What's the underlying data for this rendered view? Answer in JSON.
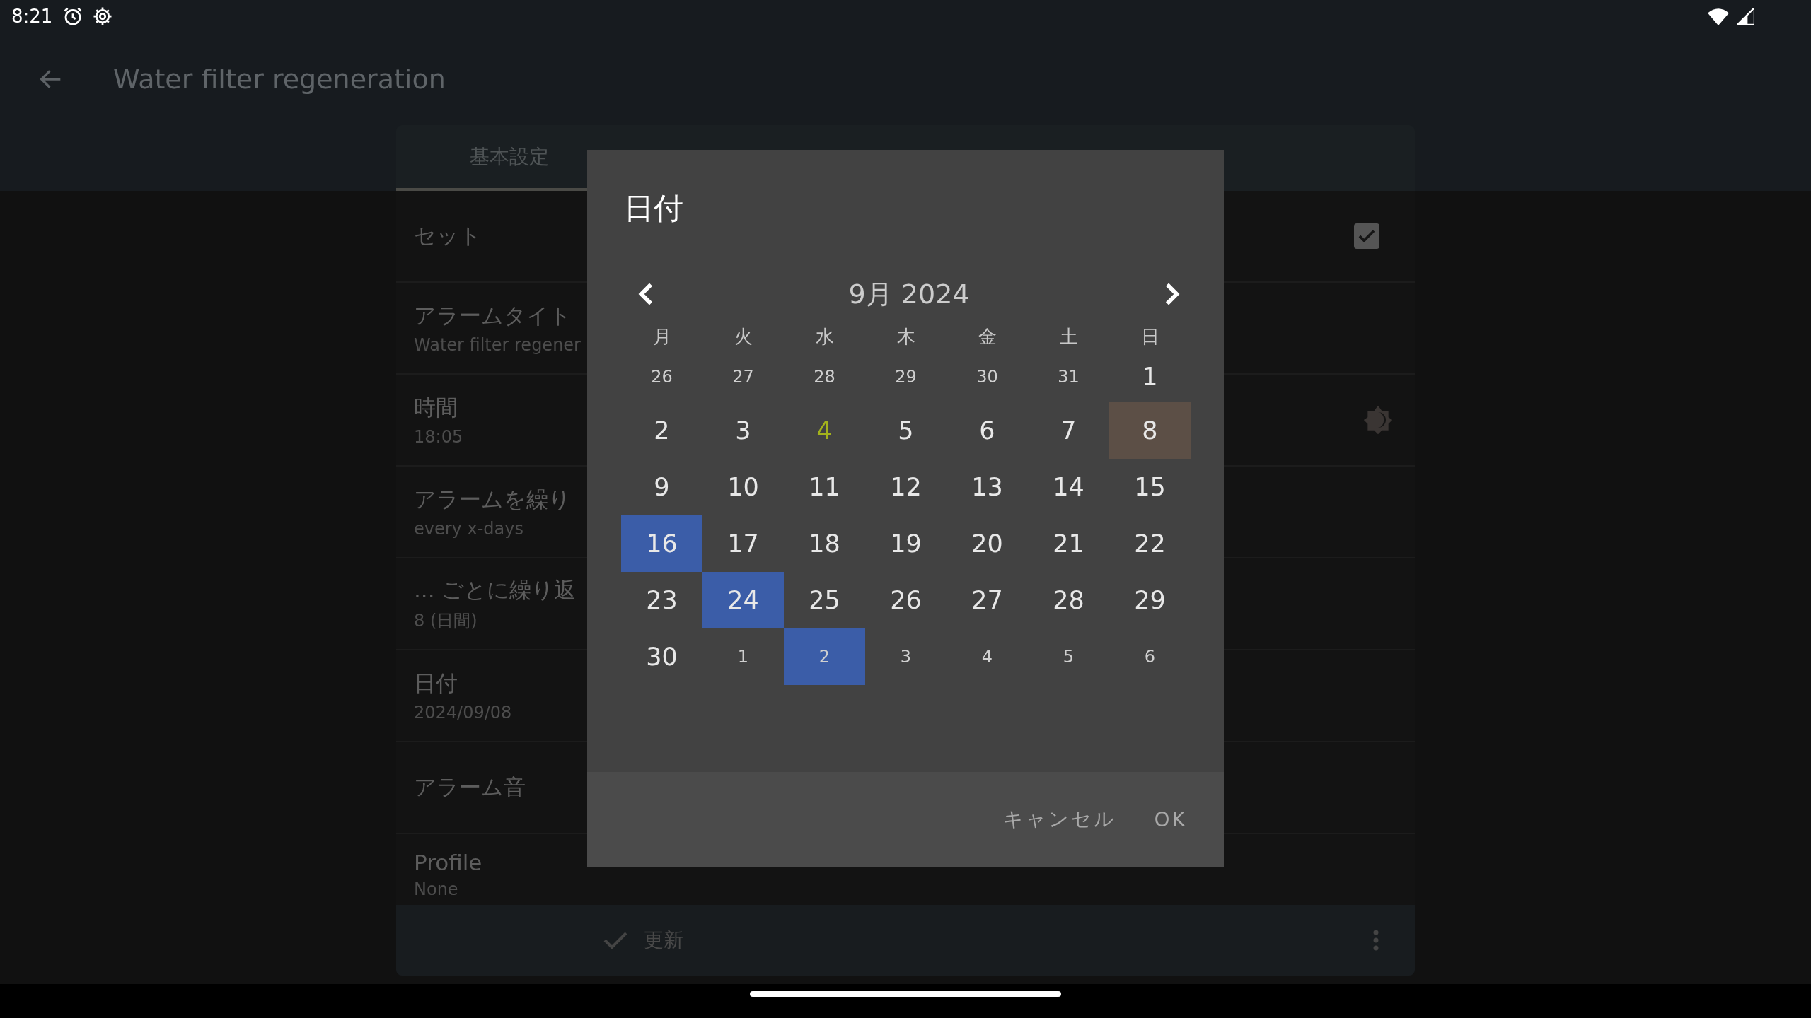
{
  "status_bar": {
    "time": "8:21"
  },
  "app_bar": {
    "title": "Water filter regeneration"
  },
  "tabs": [
    {
      "label": "基本設定",
      "selected": true
    }
  ],
  "settings": [
    {
      "label": "セット",
      "kind": "checkbox",
      "checked": true
    },
    {
      "label": "アラームタイト",
      "value": "Water filter regener",
      "kind": "text"
    },
    {
      "label": "時間",
      "value": "18:05",
      "kind": "theme"
    },
    {
      "label": "アラームを繰り",
      "value": "every x-days",
      "kind": "text"
    },
    {
      "label": "... ごとに繰り返",
      "value": "8 (日間)",
      "kind": "text"
    },
    {
      "label": "日付",
      "value": "2024/09/08",
      "kind": "text"
    },
    {
      "label": "アラーム音",
      "kind": "text"
    },
    {
      "label": "Profile",
      "value": "None",
      "kind": "text"
    }
  ],
  "bottom_bar": {
    "action": "更新"
  },
  "dialog": {
    "title": "日付",
    "month": "9月 2024",
    "weekdays": [
      "月",
      "火",
      "水",
      "木",
      "金",
      "土",
      "日"
    ],
    "days": [
      {
        "label": "26",
        "kind": "adjacent",
        "today": false,
        "selected": false,
        "highlighted": false
      },
      {
        "label": "27",
        "kind": "adjacent",
        "today": false,
        "selected": false,
        "highlighted": false
      },
      {
        "label": "28",
        "kind": "adjacent",
        "today": false,
        "selected": false,
        "highlighted": false
      },
      {
        "label": "29",
        "kind": "adjacent",
        "today": false,
        "selected": false,
        "highlighted": false
      },
      {
        "label": "30",
        "kind": "adjacent",
        "today": false,
        "selected": false,
        "highlighted": false
      },
      {
        "label": "31",
        "kind": "adjacent",
        "today": false,
        "selected": false,
        "highlighted": false
      },
      {
        "label": "1",
        "kind": "current",
        "today": false,
        "selected": false,
        "highlighted": false
      },
      {
        "label": "2",
        "kind": "current",
        "today": false,
        "selected": false,
        "highlighted": false
      },
      {
        "label": "3",
        "kind": "current",
        "today": false,
        "selected": false,
        "highlighted": false
      },
      {
        "label": "4",
        "kind": "current",
        "today": true,
        "selected": false,
        "highlighted": false
      },
      {
        "label": "5",
        "kind": "current",
        "today": false,
        "selected": false,
        "highlighted": false
      },
      {
        "label": "6",
        "kind": "current",
        "today": false,
        "selected": false,
        "highlighted": false
      },
      {
        "label": "7",
        "kind": "current",
        "today": false,
        "selected": false,
        "highlighted": false
      },
      {
        "label": "8",
        "kind": "current",
        "today": false,
        "selected": true,
        "highlighted": false
      },
      {
        "label": "9",
        "kind": "current",
        "today": false,
        "selected": false,
        "highlighted": false
      },
      {
        "label": "10",
        "kind": "current",
        "today": false,
        "selected": false,
        "highlighted": false
      },
      {
        "label": "11",
        "kind": "current",
        "today": false,
        "selected": false,
        "highlighted": false
      },
      {
        "label": "12",
        "kind": "current",
        "today": false,
        "selected": false,
        "highlighted": false
      },
      {
        "label": "13",
        "kind": "current",
        "today": false,
        "selected": false,
        "highlighted": false
      },
      {
        "label": "14",
        "kind": "current",
        "today": false,
        "selected": false,
        "highlighted": false
      },
      {
        "label": "15",
        "kind": "current",
        "today": false,
        "selected": false,
        "highlighted": false
      },
      {
        "label": "16",
        "kind": "current",
        "today": false,
        "selected": false,
        "highlighted": true
      },
      {
        "label": "17",
        "kind": "current",
        "today": false,
        "selected": false,
        "highlighted": false
      },
      {
        "label": "18",
        "kind": "current",
        "today": false,
        "selected": false,
        "highlighted": false
      },
      {
        "label": "19",
        "kind": "current",
        "today": false,
        "selected": false,
        "highlighted": false
      },
      {
        "label": "20",
        "kind": "current",
        "today": false,
        "selected": false,
        "highlighted": false
      },
      {
        "label": "21",
        "kind": "current",
        "today": false,
        "selected": false,
        "highlighted": false
      },
      {
        "label": "22",
        "kind": "current",
        "today": false,
        "selected": false,
        "highlighted": false
      },
      {
        "label": "23",
        "kind": "current",
        "today": false,
        "selected": false,
        "highlighted": false
      },
      {
        "label": "24",
        "kind": "current",
        "today": false,
        "selected": false,
        "highlighted": true
      },
      {
        "label": "25",
        "kind": "current",
        "today": false,
        "selected": false,
        "highlighted": false
      },
      {
        "label": "26",
        "kind": "current",
        "today": false,
        "selected": false,
        "highlighted": false
      },
      {
        "label": "27",
        "kind": "current",
        "today": false,
        "selected": false,
        "highlighted": false
      },
      {
        "label": "28",
        "kind": "current",
        "today": false,
        "selected": false,
        "highlighted": false
      },
      {
        "label": "29",
        "kind": "current",
        "today": false,
        "selected": false,
        "highlighted": false
      },
      {
        "label": "30",
        "kind": "current",
        "today": false,
        "selected": false,
        "highlighted": false
      },
      {
        "label": "1",
        "kind": "adjacent",
        "today": false,
        "selected": false,
        "highlighted": false
      },
      {
        "label": "2",
        "kind": "adjacent",
        "today": false,
        "selected": false,
        "highlighted": true
      },
      {
        "label": "3",
        "kind": "adjacent",
        "today": false,
        "selected": false,
        "highlighted": false
      },
      {
        "label": "4",
        "kind": "adjacent",
        "today": false,
        "selected": false,
        "highlighted": false
      },
      {
        "label": "5",
        "kind": "adjacent",
        "today": false,
        "selected": false,
        "highlighted": false
      },
      {
        "label": "6",
        "kind": "adjacent",
        "today": false,
        "selected": false,
        "highlighted": false
      }
    ],
    "buttons": [
      "キャンセル",
      "OK"
    ]
  }
}
